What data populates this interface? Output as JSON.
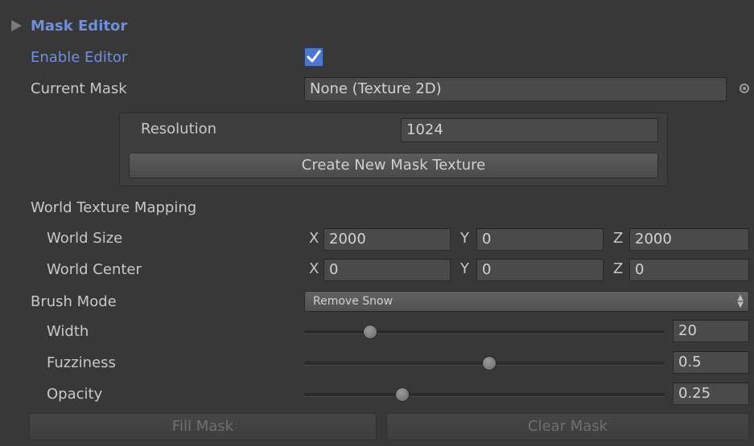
{
  "header": {
    "title": "Mask Editor",
    "collapse_icon": "triangle-right-icon"
  },
  "enable_editor": {
    "label": "Enable Editor",
    "checked": true
  },
  "current_mask": {
    "label": "Current Mask",
    "value": "None (Texture 2D)",
    "picker_icon": "object-picker-icon"
  },
  "create_panel": {
    "resolution_label": "Resolution",
    "resolution_value": "1024",
    "create_button": "Create New Mask Texture"
  },
  "world_mapping": {
    "heading": "World Texture Mapping",
    "size": {
      "label": "World Size",
      "x": "2000",
      "y": "0",
      "z": "2000"
    },
    "center": {
      "label": "World Center",
      "x": "0",
      "y": "0",
      "z": "0"
    },
    "axis_x": "X",
    "axis_y": "Y",
    "axis_z": "Z"
  },
  "brush": {
    "mode_label": "Brush Mode",
    "mode_value": "Remove Snow",
    "width": {
      "label": "Width",
      "value": "20",
      "fraction": 0.16
    },
    "fuzziness": {
      "label": "Fuzziness",
      "value": "0.5",
      "fraction": 0.49
    },
    "opacity": {
      "label": "Opacity",
      "value": "0.25",
      "fraction": 0.25
    }
  },
  "actions": {
    "fill": "Fill Mask",
    "clear": "Clear Mask"
  },
  "colors": {
    "background": "#383838",
    "accent_label": "#6f8fdc",
    "checkbox": "#4a78d0"
  }
}
